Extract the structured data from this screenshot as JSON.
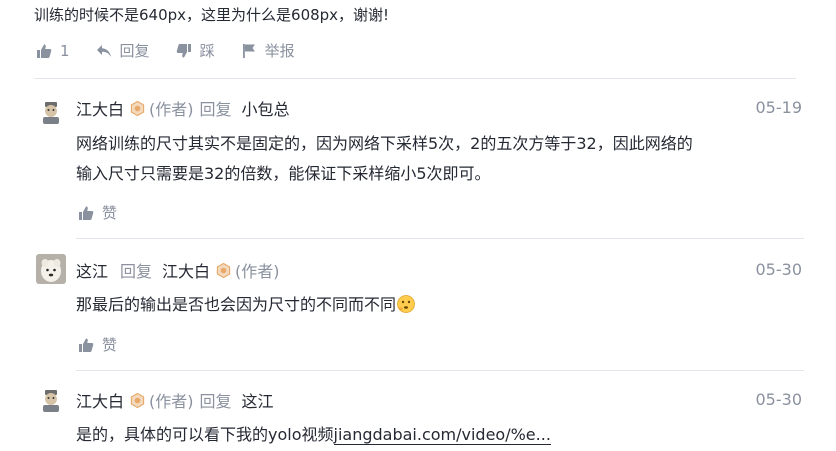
{
  "top": {
    "content": "训练的时候不是640px，这里为什么是608px，谢谢!",
    "like_count": "1",
    "reply_label": "回复",
    "dislike_label": "踩",
    "report_label": "举报"
  },
  "replies": [
    {
      "user": "江大白",
      "author_tag": "(作者)",
      "reply_word": "回复",
      "target": "小包总",
      "date": "05-19",
      "line1": "网络训练的尺寸其实不是固定的，因为网络下采样5次，2的五次方等于32，因此网络的",
      "line2": "输入尺寸只需要是32的倍数，能保证下采样缩小5次即可。",
      "like_label": "赞"
    },
    {
      "user": "这江",
      "reply_word": "回复",
      "target": "江大白",
      "target_tag": "(作者)",
      "date": "05-30",
      "content": "那最后的输出是否也会因为尺寸的不同而不同",
      "like_label": "赞"
    },
    {
      "user": "江大白",
      "author_tag": "(作者)",
      "reply_word": "回复",
      "target": "这江",
      "date": "05-30",
      "content_prefix": "是的，具体的可以看下我的yolo视频",
      "link": "jiangdabai.com/video/%e..."
    }
  ],
  "icons": {
    "like": "thumbs-up-icon",
    "reply": "reply-arrow-icon",
    "dislike": "thumbs-down-icon",
    "report": "flag-icon",
    "badge": "author-level-badge-icon",
    "emoji": "thinking-face-emoji-icon"
  },
  "colors": {
    "text": "#252933",
    "muted": "#8a919f",
    "divider": "#e4e6eb",
    "badge": "#e8a96a"
  }
}
